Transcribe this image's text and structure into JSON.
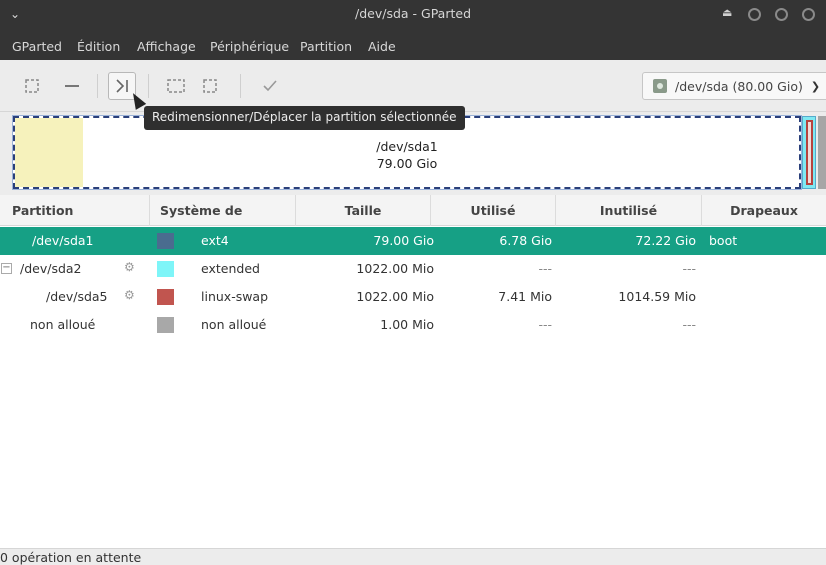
{
  "window": {
    "title": "/dev/sda - GParted",
    "menu": [
      "GParted",
      "Édition",
      "Affichage",
      "Périphérique",
      "Partition",
      "Aide"
    ]
  },
  "toolbar": {
    "tooltip": "Redimensionner/Déplacer la partition sélectionnée",
    "device": "/dev/sda  (80.00 Gio)"
  },
  "diskmap": {
    "selected_name": "/dev/sda1",
    "selected_size": "79.00 Gio"
  },
  "table": {
    "headers": [
      "Partition",
      "Système de fichiers",
      "Taille",
      "Utilisé",
      "Inutilisé",
      "Drapeaux"
    ],
    "rows": [
      {
        "partition": "/dev/sda1",
        "fs": "ext4",
        "size": "79.00 Gio",
        "used": "6.78 Gio",
        "unused": "72.22 Gio",
        "flags": "boot",
        "color": "#4a6c8f"
      },
      {
        "partition": "/dev/sda2",
        "fs": "extended",
        "size": "1022.00 Mio",
        "used": "---",
        "unused": "---",
        "flags": "",
        "color": "#7ef5f8"
      },
      {
        "partition": "/dev/sda5",
        "fs": "linux-swap",
        "size": "1022.00 Mio",
        "used": "7.41 Mio",
        "unused": "1014.59 Mio",
        "flags": "",
        "color": "#c1554f"
      },
      {
        "partition": "non alloué",
        "fs": "non alloué",
        "size": "1.00 Mio",
        "used": "---",
        "unused": "---",
        "flags": "",
        "color": "#a8a8a8"
      }
    ]
  },
  "status": {
    "text": "0 opération en attente"
  },
  "colors": {
    "selection": "#16a085",
    "titlebar": "#343434"
  }
}
